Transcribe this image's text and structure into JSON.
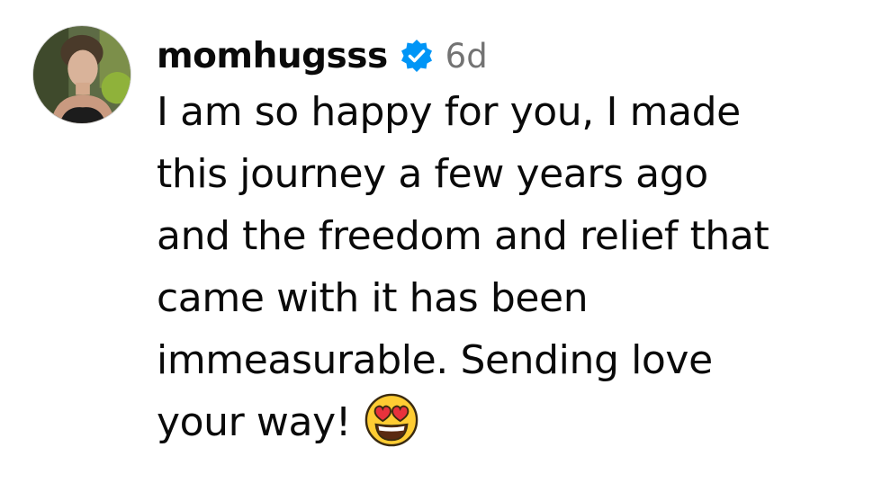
{
  "comment": {
    "username": "momhugsss",
    "verified": true,
    "time_ago": "6d",
    "text_lines": [
      "I am so happy for you, I made",
      "this journey a few years ago",
      "and the freedom and relief that",
      "came with it has been",
      "immeasurable. Sending love",
      "your way!"
    ],
    "emoji": "heart-eyes-emoji"
  },
  "colors": {
    "verified_badge": "#0095f6",
    "timestamp": "#737373",
    "text": "#0a0a0a"
  }
}
